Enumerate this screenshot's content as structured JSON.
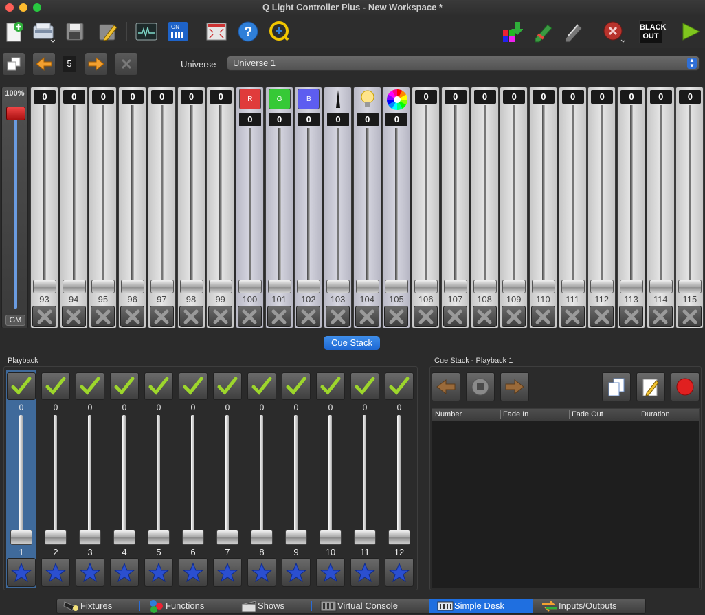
{
  "window": {
    "title": "Q Light Controller Plus - New Workspace *"
  },
  "toolbar": {
    "items": [
      "new-workspace",
      "open-workspace",
      "save-workspace",
      "save-as",
      "monitor",
      "address-tool",
      "fullscreen",
      "help",
      "about",
      "dump-dmx",
      "live-edit",
      "edit-mode",
      "stop-all",
      "blackout",
      "run"
    ],
    "blackout_line1": "BLACK",
    "blackout_line2": "OUT"
  },
  "simple_desk": {
    "page": "5",
    "universe_label": "Universe",
    "universe_selected": "Universe 1",
    "grand_master": {
      "percent": "100%",
      "label": "GM",
      "level": 1.0
    },
    "channels": [
      {
        "num": "93",
        "value": "0"
      },
      {
        "num": "94",
        "value": "0"
      },
      {
        "num": "95",
        "value": "0"
      },
      {
        "num": "96",
        "value": "0"
      },
      {
        "num": "97",
        "value": "0"
      },
      {
        "num": "98",
        "value": "0"
      },
      {
        "num": "99",
        "value": "0"
      },
      {
        "num": "100",
        "value": "0",
        "cap": "R",
        "cap_color": "#e03b3b"
      },
      {
        "num": "101",
        "value": "0",
        "cap": "G",
        "cap_color": "#36c936"
      },
      {
        "num": "102",
        "value": "0",
        "cap": "B",
        "cap_color": "#5d5df0"
      },
      {
        "num": "103",
        "value": "0",
        "cap_icon": "intensity-icon"
      },
      {
        "num": "104",
        "value": "0",
        "cap_icon": "lightbulb-icon"
      },
      {
        "num": "105",
        "value": "0",
        "cap_icon": "color-wheel-icon"
      },
      {
        "num": "106",
        "value": "0"
      },
      {
        "num": "107",
        "value": "0"
      },
      {
        "num": "108",
        "value": "0"
      },
      {
        "num": "109",
        "value": "0"
      },
      {
        "num": "110",
        "value": "0"
      },
      {
        "num": "111",
        "value": "0"
      },
      {
        "num": "112",
        "value": "0"
      },
      {
        "num": "113",
        "value": "0"
      },
      {
        "num": "114",
        "value": "0"
      },
      {
        "num": "115",
        "value": "0"
      }
    ]
  },
  "cue_stack_toggle": "Cue Stack",
  "playback": {
    "title": "Playback",
    "faders": [
      {
        "num": "1",
        "value": "0"
      },
      {
        "num": "2",
        "value": "0"
      },
      {
        "num": "3",
        "value": "0"
      },
      {
        "num": "4",
        "value": "0"
      },
      {
        "num": "5",
        "value": "0"
      },
      {
        "num": "6",
        "value": "0"
      },
      {
        "num": "7",
        "value": "0"
      },
      {
        "num": "8",
        "value": "0"
      },
      {
        "num": "9",
        "value": "0"
      },
      {
        "num": "10",
        "value": "0"
      },
      {
        "num": "11",
        "value": "0"
      },
      {
        "num": "12",
        "value": "0"
      }
    ],
    "selected": "1"
  },
  "cue_stack": {
    "title": "Cue Stack - Playback 1",
    "columns": [
      "Number",
      "Fade In",
      "Fade Out",
      "Duration"
    ]
  },
  "tabs": [
    {
      "label": "Fixtures",
      "icon": "fixtures-icon"
    },
    {
      "label": "Functions",
      "icon": "functions-icon"
    },
    {
      "label": "Shows",
      "icon": "shows-icon"
    },
    {
      "label": "Virtual Console",
      "icon": "virtual-console-icon"
    },
    {
      "label": "Simple Desk",
      "icon": "simple-desk-icon",
      "active": true
    },
    {
      "label": "Inputs/Outputs",
      "icon": "inputs-outputs-icon"
    }
  ]
}
